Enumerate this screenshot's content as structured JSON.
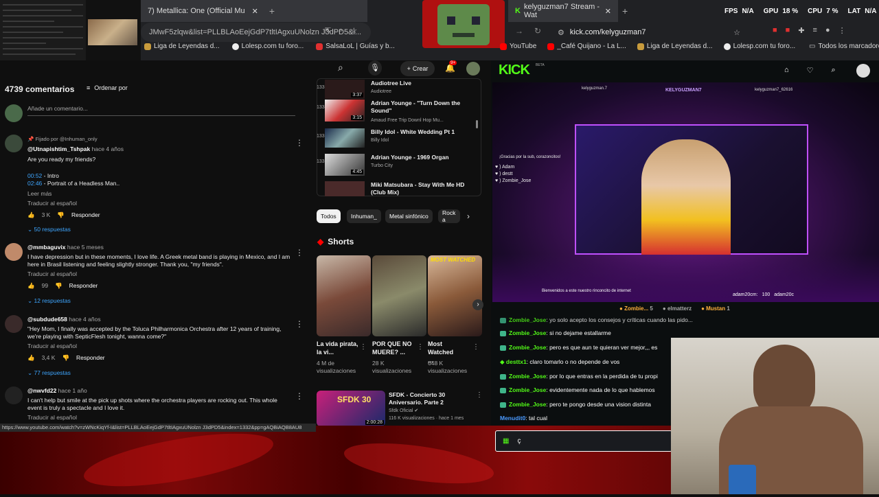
{
  "browser_left": {
    "tab_title": "7) Metallica: One (Official Mu",
    "url": "JMwF5zlqw&list=PLLBLAoEejGdP7tltIAgxuUNolzn J3dPD5&i...",
    "bookmarks": [
      "Liga de Leyendas d...",
      "Lolesp.com tu foro...",
      "SalsaLoL | Guías y b..."
    ]
  },
  "browser_right": {
    "tab_title": "kelyguzman7 Stream - Wat",
    "url": "kick.com/kelyguzman7",
    "bookmarks": [
      "YouTube",
      "_Café Quijano - La L...",
      "Liga de Leyendas d...",
      "Lolesp.com tu foro..."
    ],
    "all_bookmarks": "Todos los marcadores",
    "perf": {
      "fps_label": "FPS",
      "fps": "N/A",
      "gpu_label": "GPU",
      "gpu": "18 %",
      "cpu_label": "CPU",
      "cpu": "7 %",
      "lat_label": "LAT",
      "lat": "N/A"
    }
  },
  "youtube": {
    "create_label": "Crear",
    "notif_count": "9+",
    "comments_count": "4739 comentarios",
    "sort_label": "Ordenar por",
    "add_comment_placeholder": "Añade un comentario...",
    "pinned": "Fijado por @Inhuman_only",
    "comments": [
      {
        "user": "@Utnapishtim_Tshpak",
        "when": "hace 4 años",
        "lines": [
          "Are you ready my friends?"
        ],
        "ts1": "00:52",
        "ts1_text": " - Intro",
        "ts2": "02:46",
        "ts2_text": " - Portrait of a Headless Man..",
        "more": "Leer más",
        "translate": "Traducir al español",
        "likes": "3 K",
        "reply": "Responder",
        "replies": "50 respuestas"
      },
      {
        "user": "@mmbaguvix",
        "when": "hace 5 meses",
        "lines": [
          "I have depression but in these moments, I love life. A Greek metal band is playing in Mexico, and I am",
          "here in Brasil listening and feeling slightly stronger. Thank you, \"my friends\"."
        ],
        "translate": "Traducir al español",
        "likes": "99",
        "reply": "Responder",
        "replies": "12 respuestas"
      },
      {
        "user": "@subdude658",
        "when": "hace 4 años",
        "lines": [
          "\"Hey Mom, I finally was accepted by the Toluca Philharmonica Orchestra after 12 years of training,",
          "we're playing with SepticFlesh tonight, wanna come?\""
        ],
        "translate": "Traducir al español",
        "likes": "3,4 K",
        "reply": "Responder",
        "replies": "77 respuestas"
      },
      {
        "user": "@nwvfd22",
        "when": "hace 1 año",
        "lines": [
          "I can't help but smile at the pick up shots where the orchestra players are rocking out.  This whole",
          "event is truly a spectacle and I love it."
        ],
        "translate": "Traducir al español"
      }
    ],
    "playlist": [
      {
        "title": "Audiotree Live",
        "channel": "Audiotree",
        "duration": "3:37",
        "idx": "1333"
      },
      {
        "title": "Adrian Younge - \"Turn Down the Sound\"",
        "channel": "Amaud Free Trip Downl Hop Mu...",
        "duration": "3:15",
        "idx": "1334"
      },
      {
        "title": "Billy Idol - White Wedding Pt 1",
        "channel": "Billy Idol",
        "duration": "",
        "idx": "1335"
      },
      {
        "title": "Adrian Younge - 1969 Organ",
        "channel": "Turbo City",
        "duration": "4:45",
        "idx": "1336"
      },
      {
        "title": "Miki Matsubara - Stay With Me HD (Club Mix)",
        "channel": "",
        "duration": "",
        "idx": ""
      }
    ],
    "chips": [
      "Todos",
      "Inhuman_",
      "Metal sinfónico",
      "Rock a"
    ],
    "shorts_title": "Shorts",
    "shorts": [
      {
        "title": "La vida pirata, la vi...",
        "views": "4 M de visualizaciones"
      },
      {
        "title": "POR QUE NO MUERE? ...",
        "views": "28 K visualizaciones"
      },
      {
        "title": "Most Watched ...",
        "views": "648 K visualizaciones",
        "banner": "MOST WATCHED"
      }
    ],
    "video": {
      "title": "SFDK - Concierto 30 Aniversario. Parte 2",
      "channel": "Sfdk Oficial",
      "meta": "116 K visualizaciones · hace 1 mes",
      "duration": "2:00:28",
      "thumb_text": "SFDK 30"
    },
    "status_url": "https://www.youtube.com/watch?v=zWNcKiqYf-I&list=PLLBLAoEejGdP7tltIAgxuUNolzn J3dPD5&index=1332&pp=gAQBiAQB8AU8"
  },
  "kick": {
    "logo": "KICK",
    "beta": "BETA",
    "overlay_top": [
      "kelyguzman.7",
      "KELYGUZMAN7",
      "kelyguzman7_62616"
    ],
    "overlay_sub_msg": "¡Gracias por la sub, corazoncitos!",
    "overlay_subs": [
      "Adam",
      "destt",
      "Zombie_Jose"
    ],
    "overlay_welcome": "Bienvenidos a este nuestro rinconcito de internet",
    "overlay_bottom_right": [
      "adam20cm:",
      "100",
      "adam20c"
    ],
    "pinned_users": [
      "Zombie...",
      "elmatterz",
      "Mustan"
    ],
    "pinned_counts": [
      "5",
      "1"
    ],
    "chat": [
      {
        "user": "Zombie_Jose",
        "msg": "yo solo acepto los consejos y críticas cuando las pido..."
      },
      {
        "user": "Zombie_Jose",
        "msg": "si no dejame estallarme"
      },
      {
        "user": "Zombie_Jose",
        "msg": "pero es que aun te quieran ver mejor,,, es"
      },
      {
        "user": "desttx1",
        "msg": "claro tomarlo o no depende de vos"
      },
      {
        "user": "Zombie_Jose",
        "msg": "por lo que entras en la perdida de tu propi"
      },
      {
        "user": "Zombie_Jose",
        "msg": "evidentemente nada de lo que hablemos"
      },
      {
        "user": "Zombie_Jose",
        "msg": "pero te pongo desde una vision distinta"
      },
      {
        "user": "Menudit0",
        "msg": "tal cual"
      }
    ],
    "chat_input": "ç"
  },
  "colors": {
    "kick_green": "#53fc18",
    "yt_blue": "#3ea6ff",
    "purple": "#a020f0"
  }
}
